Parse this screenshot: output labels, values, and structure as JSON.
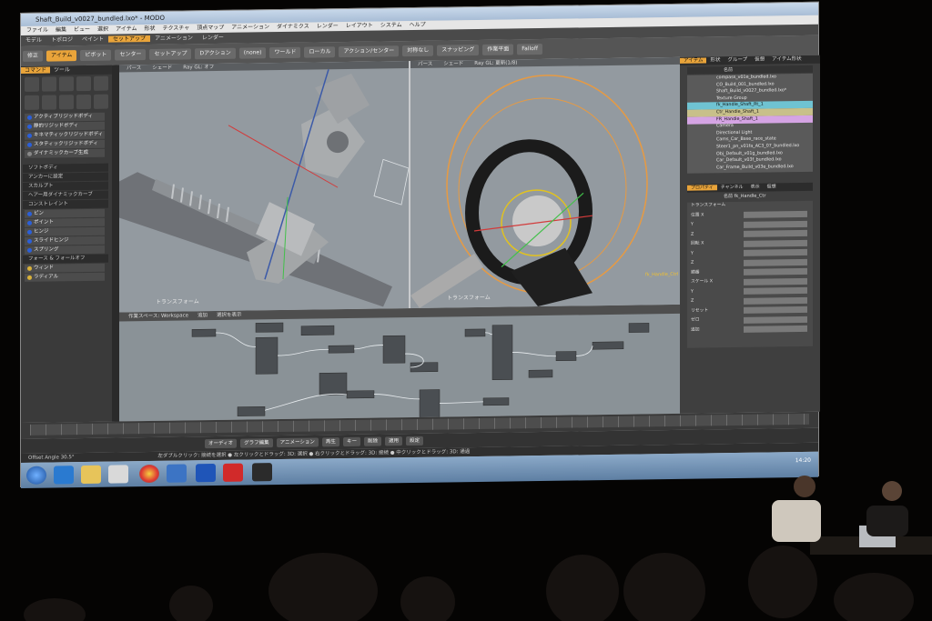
{
  "window": {
    "title": "Shaft_Build_v0027_bundled.lxo* - MODO"
  },
  "menus": [
    "ファイル",
    "編集",
    "ビュー",
    "選択",
    "アイテム",
    "形状",
    "テクスチャ",
    "頂点マップ",
    "アニメーション",
    "ダイナミクス",
    "レンダー",
    "レイアウト",
    "システム",
    "ヘルプ"
  ],
  "mode_tabs": [
    "モデル",
    "トポロジ",
    "ペイント",
    "セットアップ",
    "アニメーション",
    "レンダー"
  ],
  "active_mode": "セットアップ",
  "toolbar": {
    "items": [
      "修正",
      "アイテム",
      "ピボット",
      "センター",
      "セットアップ",
      "Dアクション",
      "(none)",
      "ワールド",
      "ローカル",
      "アクション/センター",
      "対称なし",
      "スナッピング",
      "作業平面",
      "Falloff"
    ]
  },
  "left_panel": {
    "tabs": [
      "コマンド",
      "ツール"
    ],
    "buttons": [
      {
        "label": "アクティブリジッドボディ",
        "color": "#2b5fd9"
      },
      {
        "label": "静的リジッドボディ",
        "color": "#2b5fd9"
      },
      {
        "label": "キネマティックリジッドボディ",
        "color": "#2b5fd9"
      },
      {
        "label": "スタティックリジッドボディ",
        "color": "#2b5fd9"
      },
      {
        "label": "ダイナミックカーブ生成",
        "color": "#888888"
      }
    ],
    "sections": [
      "ソフトボディ",
      "アンカーに設定",
      "スカルプト",
      "ヘアー用ダイナミックカーブ",
      "コンストレイント",
      "フォース & フォールオフ"
    ],
    "constraint_items": [
      "ピン",
      "ポイント",
      "ヒンジ",
      "スライドヒンジ",
      "スプリング"
    ],
    "force_items": [
      "ウィンド",
      "ラディアル"
    ]
  },
  "viewport_left": {
    "header": [
      "パース",
      "シェード",
      "Ray GL: オフ"
    ],
    "footer": "トランスフォーム"
  },
  "viewport_right": {
    "header": [
      "パース",
      "シェード",
      "Ray GL: 更新(1/8)"
    ],
    "footer": "トランスフォーム",
    "overlay": "fk_Handle_Ctrl"
  },
  "node_editor": {
    "header": [
      "作業スペース: Workspace",
      "追加",
      "選択を表示"
    ]
  },
  "right_panel": {
    "tabs": [
      "アイテム",
      "形状",
      "グループ",
      "仮想",
      "アイテム形状"
    ],
    "tree_header": "名前",
    "tree": [
      "compass_v01e_bundled.lxo",
      "CO_Build_001_bundled.lxo",
      "Shaft_Build_v0027_bundled.lxo*",
      "Texture Group",
      "fk_Handle_Shaft_Rt_1",
      "Ctr_Handle_Shaft_1",
      "FR_Handle_Shaft_1",
      "Camera",
      "Directional Light",
      "Cams_Car_Base_race_state",
      "Steer1_pn_v01fa_AC3_07_bundled.lxo",
      "Obj_Default_v01g_bundled.lxo",
      "Car_Default_v03f_bundled.lxo",
      "Car_Frame_Build_v03e_bundled.lxo"
    ],
    "props_tabs": [
      "プロパティ",
      "チャンネル",
      "表示",
      "仮想"
    ],
    "props_name": "名前  fk_Handle_Ctr",
    "props": [
      "トランスフォーム",
      "位置 X",
      "Y",
      "Z",
      "回転 X",
      "Y",
      "Z",
      "順番",
      "スケール X",
      "Y",
      "Z",
      "リセット",
      "ゼロ",
      "追加"
    ]
  },
  "playbar": [
    "オーディオ",
    "グラフ編集",
    "アニメーション",
    "再生",
    "キー",
    "削除",
    "適用",
    "設定"
  ],
  "statusbar": "Offset Angle 30.5°",
  "status_hint": "左ダブルクリック: 接続を選択 ● 左クリックとドラッグ: 3D: 選択 ● 右クリックとドラッグ: 3D: 接続 ● 中クリックとドラッグ: 3D: 通過",
  "clock": "14:20"
}
